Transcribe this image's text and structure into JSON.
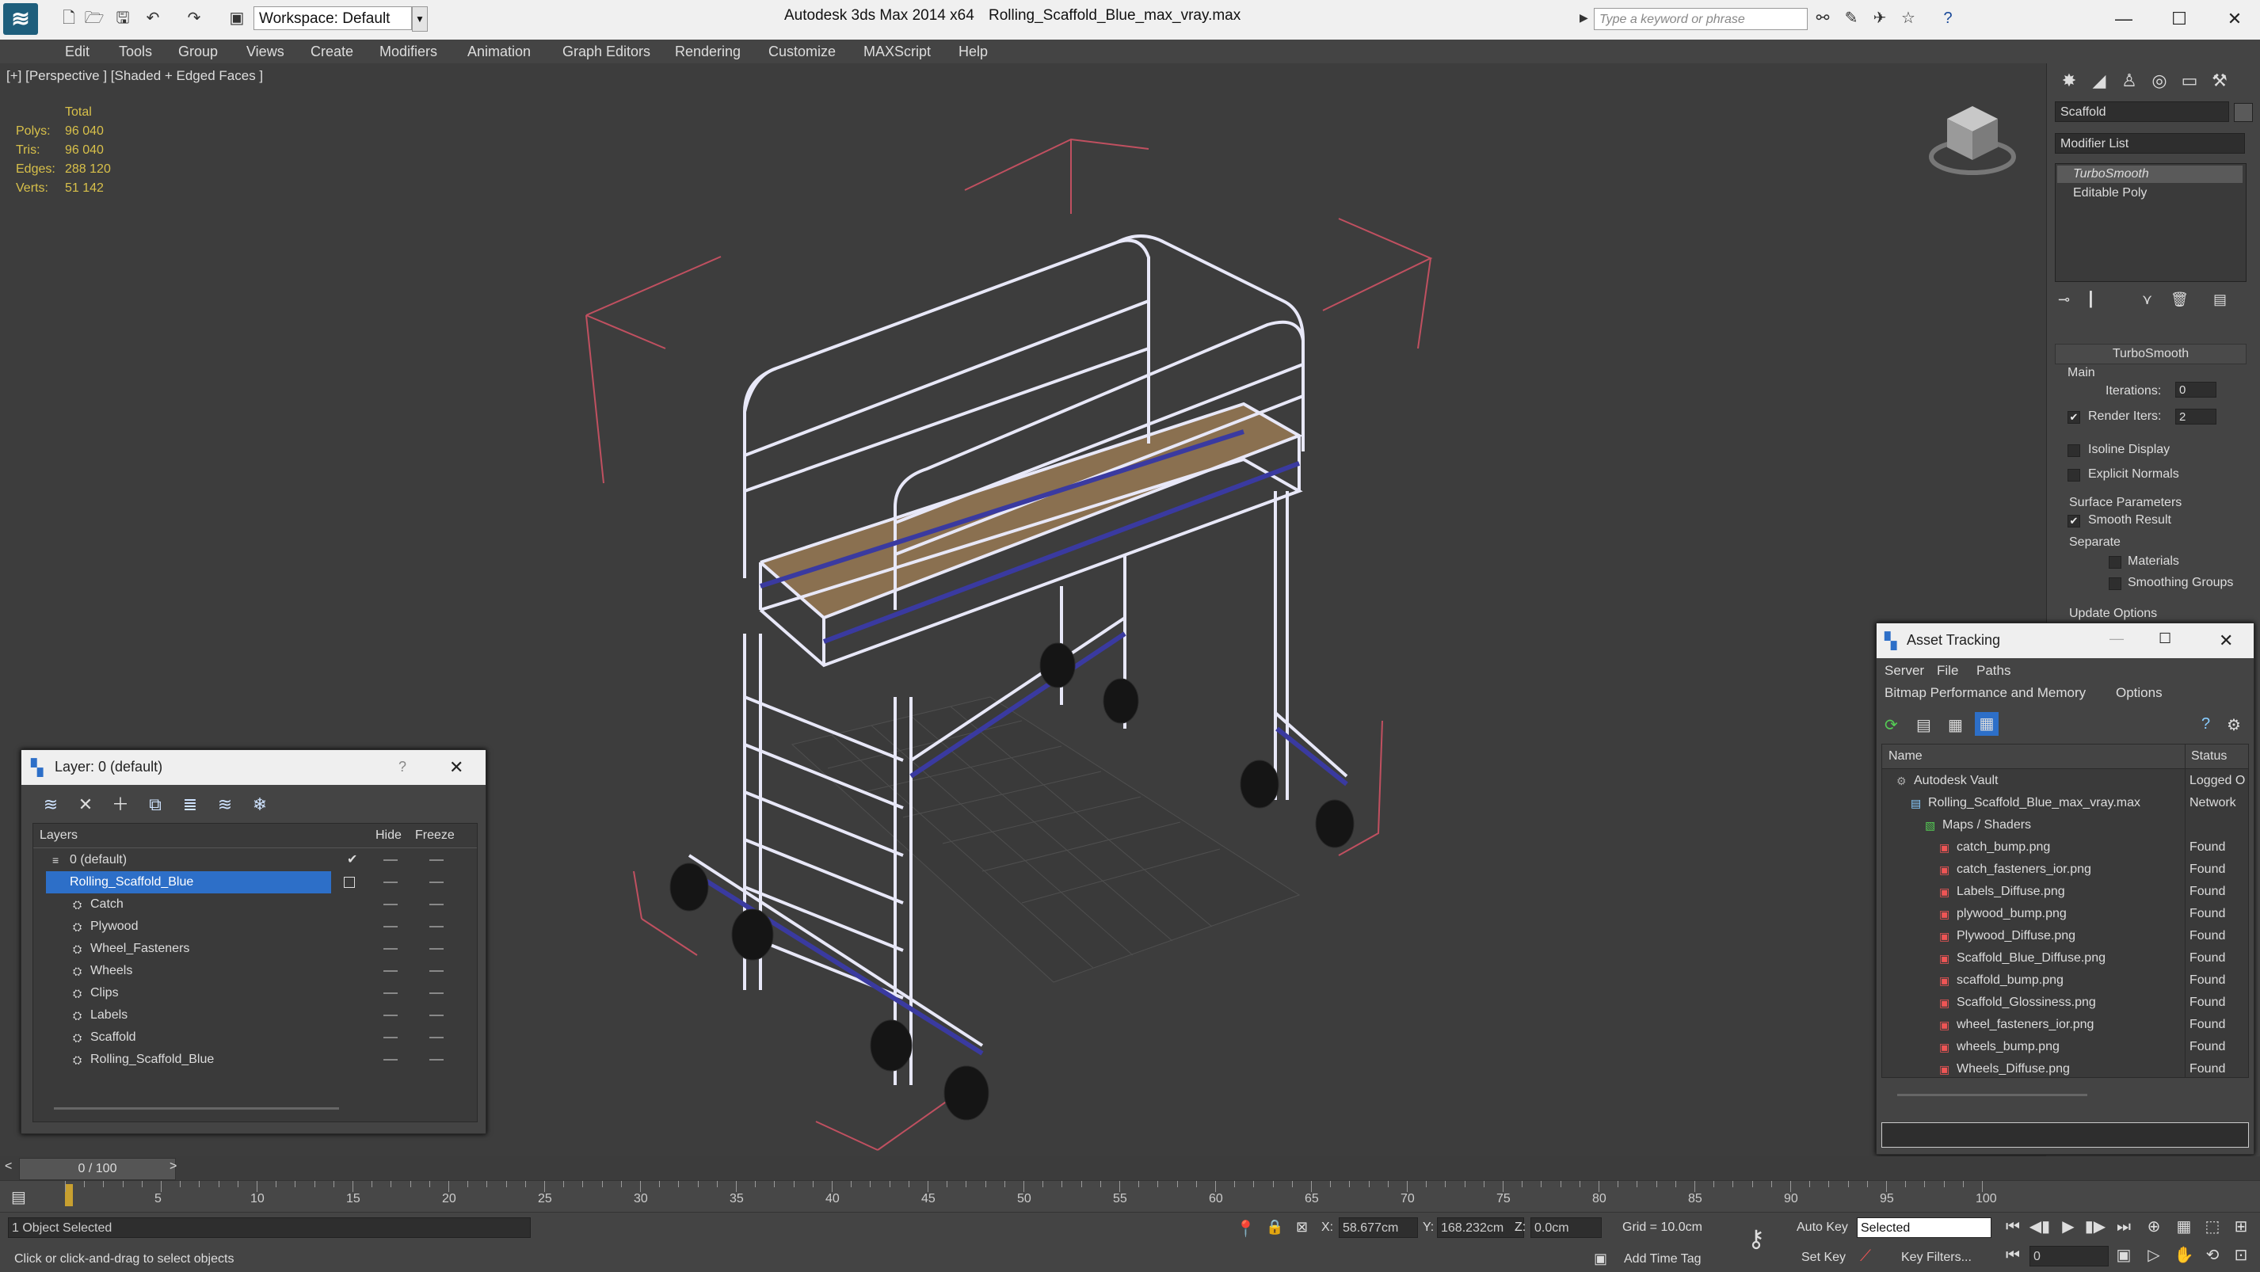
{
  "titlebar": {
    "workspace": "Workspace: Default",
    "app_title": "Autodesk 3ds Max  2014 x64",
    "file_title": "Rolling_Scaffold_Blue_max_vray.max",
    "search_placeholder": "Type a keyword or phrase"
  },
  "menu": [
    "Edit",
    "Tools",
    "Group",
    "Views",
    "Create",
    "Modifiers",
    "Animation",
    "Graph Editors",
    "Rendering",
    "Customize",
    "MAXScript",
    "Help"
  ],
  "viewport": {
    "label": "[+] [Perspective ] [Shaded + Edged Faces ]",
    "stats_header": "Total",
    "stats": [
      {
        "label": "Polys:",
        "value": "96 040"
      },
      {
        "label": "Tris:",
        "value": "96 040"
      },
      {
        "label": "Edges:",
        "value": "288 120"
      },
      {
        "label": "Verts:",
        "value": "51 142"
      }
    ]
  },
  "command_panel": {
    "object_name": "Scaffold",
    "modifier_list": "Modifier List",
    "stack": [
      "TurboSmooth",
      "Editable Poly"
    ],
    "rollout_title": "TurboSmooth",
    "main_label": "Main",
    "iterations_label": "Iterations:",
    "iterations_value": "0",
    "render_iters_label": "Render Iters:",
    "render_iters_value": "2",
    "isoline_label": "Isoline Display",
    "explicit_normals_label": "Explicit Normals",
    "surface_params_label": "Surface Parameters",
    "smooth_result_label": "Smooth Result",
    "separate_label": "Separate",
    "materials_label": "Materials",
    "smoothing_groups_label": "Smoothing Groups",
    "update_options_label": "Update Options"
  },
  "layer_dialog": {
    "title": "Layer: 0 (default)",
    "help": "?",
    "columns": {
      "layers": "Layers",
      "hide": "Hide",
      "freeze": "Freeze"
    },
    "rows": [
      {
        "name": "0 (default)",
        "indent": 0,
        "selected": false,
        "active": true
      },
      {
        "name": "Rolling_Scaffold_Blue",
        "indent": 0,
        "selected": true,
        "active": false
      },
      {
        "name": "Catch",
        "indent": 1,
        "selected": false,
        "active": false
      },
      {
        "name": "Plywood",
        "indent": 1,
        "selected": false,
        "active": false
      },
      {
        "name": "Wheel_Fasteners",
        "indent": 1,
        "selected": false,
        "active": false
      },
      {
        "name": "Wheels",
        "indent": 1,
        "selected": false,
        "active": false
      },
      {
        "name": "Clips",
        "indent": 1,
        "selected": false,
        "active": false
      },
      {
        "name": "Labels",
        "indent": 1,
        "selected": false,
        "active": false
      },
      {
        "name": "Scaffold",
        "indent": 1,
        "selected": false,
        "active": false
      },
      {
        "name": "Rolling_Scaffold_Blue",
        "indent": 1,
        "selected": false,
        "active": false
      }
    ]
  },
  "asset_dialog": {
    "title": "Asset Tracking",
    "menu1": [
      "Server",
      "File",
      "Paths"
    ],
    "menu2": [
      "Bitmap Performance and Memory",
      "Options"
    ],
    "columns": {
      "name": "Name",
      "status": "Status"
    },
    "rows": [
      {
        "name": "Autodesk Vault",
        "status": "Logged O",
        "indent": 1
      },
      {
        "name": "Rolling_Scaffold_Blue_max_vray.max",
        "status": "Network",
        "indent": 2
      },
      {
        "name": "Maps / Shaders",
        "status": "",
        "indent": 3
      },
      {
        "name": "catch_bump.png",
        "status": "Found",
        "indent": 4
      },
      {
        "name": "catch_fasteners_ior.png",
        "status": "Found",
        "indent": 4
      },
      {
        "name": "Labels_Diffuse.png",
        "status": "Found",
        "indent": 4
      },
      {
        "name": "plywood_bump.png",
        "status": "Found",
        "indent": 4
      },
      {
        "name": "Plywood_Diffuse.png",
        "status": "Found",
        "indent": 4
      },
      {
        "name": "Scaffold_Blue_Diffuse.png",
        "status": "Found",
        "indent": 4
      },
      {
        "name": "scaffold_bump.png",
        "status": "Found",
        "indent": 4
      },
      {
        "name": "Scaffold_Glossiness.png",
        "status": "Found",
        "indent": 4
      },
      {
        "name": "wheel_fasteners_ior.png",
        "status": "Found",
        "indent": 4
      },
      {
        "name": "wheels_bump.png",
        "status": "Found",
        "indent": 4
      },
      {
        "name": "Wheels_Diffuse.png",
        "status": "Found",
        "indent": 4
      }
    ]
  },
  "timeline": {
    "frame_counter": "0 / 100",
    "ticks": [
      "5",
      "10",
      "15",
      "20",
      "25",
      "30",
      "35",
      "40",
      "45",
      "50",
      "55",
      "60",
      "65",
      "70",
      "75",
      "80",
      "85",
      "90",
      "95",
      "100"
    ]
  },
  "status": {
    "selection": "1 Object Selected",
    "prompt": "Click or click-and-drag to select objects",
    "x_label": "X:",
    "x_value": "58.677cm",
    "y_label": "Y:",
    "y_value": "168.232cm",
    "z_label": "Z:",
    "z_value": "0.0cm",
    "grid": "Grid = 10.0cm",
    "add_time_tag": "Add Time Tag",
    "auto_key": "Auto Key",
    "set_key": "Set Key",
    "selected_dropdown": "Selected",
    "key_filters": "Key Filters...",
    "frame_value": "0"
  },
  "colors": {
    "selection_blue": "#2d6fc8",
    "stats_yellow": "#d8c04a",
    "scaffold_blue": "#3a3aa0",
    "plywood": "#8a7050",
    "bbox_red": "#c05060"
  }
}
